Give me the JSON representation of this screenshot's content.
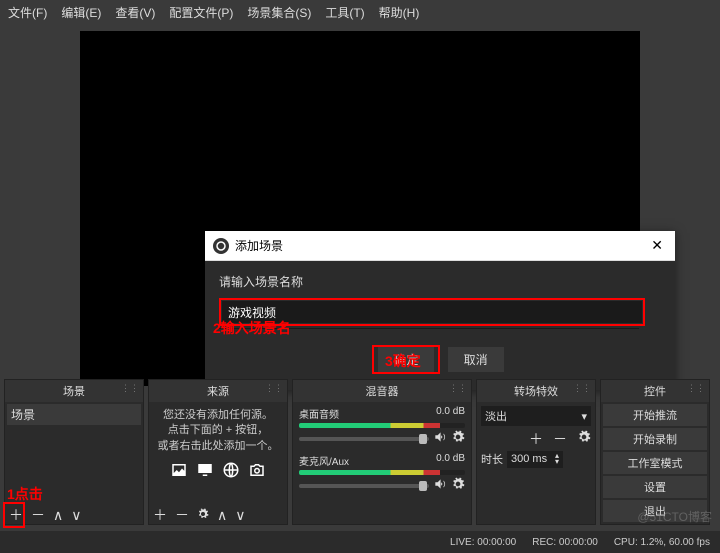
{
  "menu": {
    "file": "文件(F)",
    "edit": "编辑(E)",
    "view": "查看(V)",
    "profile": "配置文件(P)",
    "sceneCollection": "场景集合(S)",
    "tools": "工具(T)",
    "help": "帮助(H)"
  },
  "dialog": {
    "title": "添加场景",
    "prompt": "请输入场景名称",
    "value": "游戏视频",
    "ok": "确定",
    "cancel": "取消"
  },
  "annotations": {
    "click": "1点击",
    "input": "2输入场景名",
    "confirm": "3确定"
  },
  "panels": {
    "scenes": {
      "title": "场景",
      "items": [
        "场景"
      ]
    },
    "sources": {
      "title": "来源",
      "empty1": "您还没有添加任何源。",
      "empty2": "点击下面的 + 按钮，",
      "empty3": "或者右击此处添加一个。"
    },
    "mixer": {
      "title": "混音器",
      "ch1": {
        "name": "桌面音频",
        "level": "0.0 dB"
      },
      "ch2": {
        "name": "麦克风/Aux",
        "level": "0.0 dB"
      }
    },
    "transitions": {
      "title": "转场特效",
      "effect": "淡出",
      "durationLabel": "时长",
      "duration": "300 ms"
    },
    "controls": {
      "title": "控件",
      "b1": "开始推流",
      "b2": "开始录制",
      "b3": "工作室模式",
      "b4": "设置",
      "b5": "退出"
    }
  },
  "status": {
    "live": "LIVE: 00:00:00",
    "rec": "REC: 00:00:00",
    "cpu": "CPU: 1.2%, 60.00 fps"
  },
  "watermark": "@51CTO博客"
}
